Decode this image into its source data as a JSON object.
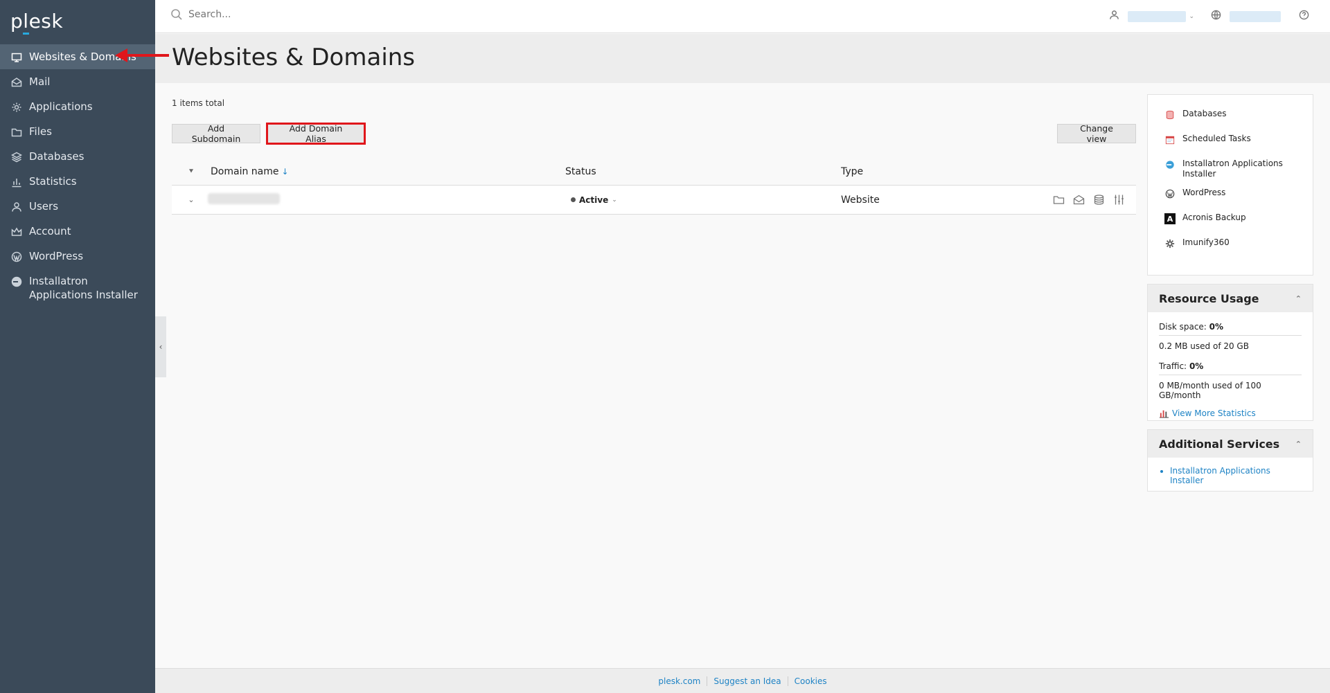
{
  "app": {
    "logo": "plesk"
  },
  "sidebar": {
    "items": [
      {
        "label": "Websites & Domains",
        "icon": "monitor-icon",
        "active": true
      },
      {
        "label": "Mail",
        "icon": "mail-icon"
      },
      {
        "label": "Applications",
        "icon": "gear-icon"
      },
      {
        "label": "Files",
        "icon": "folder-icon"
      },
      {
        "label": "Databases",
        "icon": "layers-icon"
      },
      {
        "label": "Statistics",
        "icon": "bar-chart-icon"
      },
      {
        "label": "Users",
        "icon": "user-icon"
      },
      {
        "label": "Account",
        "icon": "crown-icon"
      },
      {
        "label": "WordPress",
        "icon": "wordpress-icon"
      },
      {
        "label": "Installatron Applications Installer",
        "icon": "installatron-icon"
      }
    ]
  },
  "topbar": {
    "search_placeholder": "Search..."
  },
  "page": {
    "title": "Websites & Domains",
    "items_total": "1 items total"
  },
  "toolbar": {
    "add_subdomain": "Add Subdomain",
    "add_domain_alias": "Add Domain Alias",
    "change_view": "Change view"
  },
  "table": {
    "headers": {
      "domain": "Domain name",
      "status": "Status",
      "type": "Type"
    },
    "rows": [
      {
        "status": "Active",
        "type": "Website"
      }
    ]
  },
  "tools": [
    {
      "label": "Databases",
      "icon": "database-icon",
      "color": "#e05a5a"
    },
    {
      "label": "Scheduled Tasks",
      "icon": "calendar-icon",
      "color": "#d64545"
    },
    {
      "label": "Installatron Applications Installer",
      "icon": "installatron-icon",
      "color": "#3b9fd8"
    },
    {
      "label": "WordPress",
      "icon": "wordpress-icon",
      "color": "#464646"
    },
    {
      "label": "Acronis Backup",
      "icon": "acronis-icon",
      "color": "#111111"
    },
    {
      "label": "Imunify360",
      "icon": "gear-icon",
      "color": "#555555"
    }
  ],
  "resource_usage": {
    "title": "Resource Usage",
    "disk_label": "Disk space:",
    "disk_value": "0%",
    "disk_detail": "0.2 MB used of 20 GB",
    "traffic_label": "Traffic:",
    "traffic_value": "0%",
    "traffic_detail": "0 MB/month used of 100 GB/month",
    "link": "View More Statistics"
  },
  "additional_services": {
    "title": "Additional Services",
    "items": [
      "Installatron Applications Installer"
    ]
  },
  "footer": {
    "links": [
      "plesk.com",
      "Suggest an Idea",
      "Cookies"
    ]
  },
  "colors": {
    "sidebar": "#3b4a59",
    "sidebar_active": "#536474",
    "link": "#1e83c5",
    "highlight": "#e0161b"
  }
}
